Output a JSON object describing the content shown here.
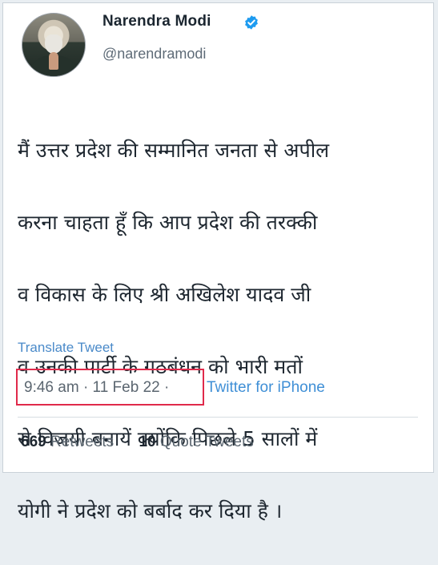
{
  "author": {
    "name": "Narendra Modi",
    "handle": "@narendramodi",
    "verified_icon": "verified-badge-icon",
    "verified_color": "#1d9bf0"
  },
  "tweet": {
    "text_lines": [
      "मैं उत्तर प्रदेश की सम्मानित जनता से अपील",
      "करना चाहता हूँ कि आप प्रदेश की तरक्की",
      "व विकास के लिए श्री अखिलेश यादव जी",
      "व उनकी पार्टी के गठबंधन को भारी मतों",
      "से विजयी बनायें क्योंकि पिछले 5 सालों में",
      "योगी ने प्रदेश को बर्बाद कर दिया है ।"
    ],
    "translate_label": "Translate Tweet",
    "time": "9:46 am",
    "date": "11 Feb 22",
    "separator": "·",
    "source": "Twitter for iPhone",
    "highlight_color": "#e02a4b"
  },
  "stats": {
    "retweets_count": "669",
    "retweets_label": "Retweets",
    "quote_count": "10",
    "quote_label": "Quote Tweets"
  }
}
